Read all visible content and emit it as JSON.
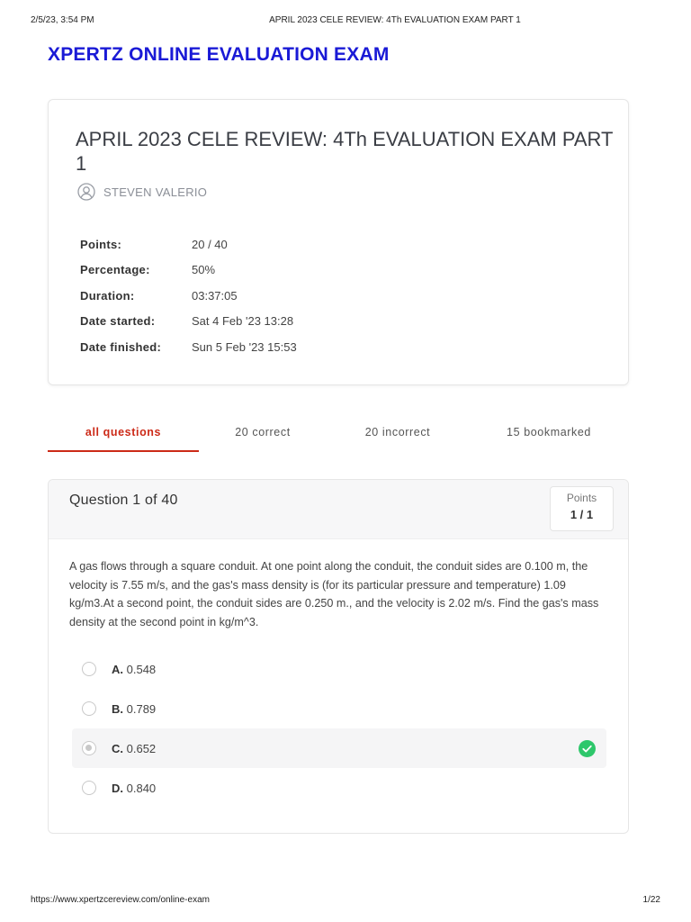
{
  "print_header": {
    "datetime": "2/5/23, 3:54 PM",
    "title": "APRIL 2023 CELE REVIEW: 4Th EVALUATION EXAM PART 1"
  },
  "brand": "XPERTZ ONLINE EVALUATION EXAM",
  "summary": {
    "exam_title": "APRIL 2023 CELE REVIEW: 4Th EVALUATION EXAM PART 1",
    "user_name": "STEVEN VALERIO",
    "stats": [
      {
        "label": "Points:",
        "value": "20 / 40"
      },
      {
        "label": "Percentage:",
        "value": "50%"
      },
      {
        "label": "Duration:",
        "value": "03:37:05"
      },
      {
        "label": "Date started:",
        "value": "Sat 4 Feb '23 13:28"
      },
      {
        "label": "Date finished:",
        "value": "Sun 5 Feb '23 15:53"
      }
    ]
  },
  "tabs": [
    {
      "label": "all questions",
      "active": true
    },
    {
      "label": "20 correct"
    },
    {
      "label": "20 incorrect"
    },
    {
      "label": "15 bookmarked"
    }
  ],
  "question": {
    "number_label": "Question 1 of 40",
    "points_label": "Points",
    "points_value": "1 / 1",
    "text": "A gas flows through a square conduit. At one point along the conduit, the conduit sides are 0.100 m, the velocity is 7.55 m/s, and the gas's mass density is (for its particular pressure and temperature) 1.09 kg/m3.At a second point, the conduit sides are 0.250 m., and the velocity is 2.02 m/s. Find the gas's mass density at the second point in kg/m^3.",
    "options": [
      {
        "letter": "A.",
        "value": "0.548",
        "selected": false,
        "correct": false
      },
      {
        "letter": "B.",
        "value": "0.789",
        "selected": false,
        "correct": false
      },
      {
        "letter": "C.",
        "value": "0.652",
        "selected": true,
        "correct": true
      },
      {
        "letter": "D.",
        "value": "0.840",
        "selected": false,
        "correct": false
      }
    ]
  },
  "print_footer": {
    "url": "https://www.xpertzcereview.com/online-exam",
    "page": "1/22"
  },
  "colors": {
    "brand": "#1a1ad6",
    "active_tab": "#cc2a18",
    "correct_check": "#2ec76b"
  },
  "icons": {
    "user": "user-circle-icon",
    "correct": "check-circle-icon"
  }
}
